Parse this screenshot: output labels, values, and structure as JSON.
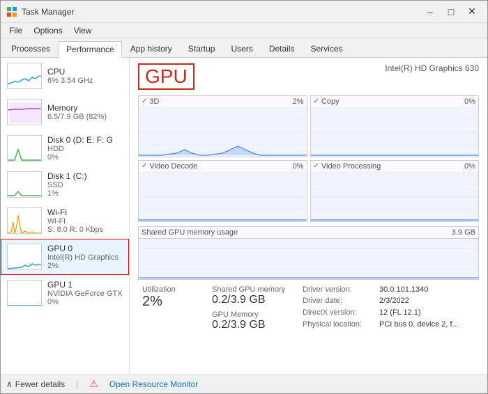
{
  "window": {
    "title": "Task Manager",
    "controls": {
      "minimize": "–",
      "maximize": "□",
      "close": "✕"
    }
  },
  "menu": {
    "items": [
      "File",
      "Options",
      "View"
    ]
  },
  "tabs": [
    {
      "label": "Processes",
      "active": false
    },
    {
      "label": "Performance",
      "active": true
    },
    {
      "label": "App history",
      "active": false
    },
    {
      "label": "Startup",
      "active": false
    },
    {
      "label": "Users",
      "active": false
    },
    {
      "label": "Details",
      "active": false
    },
    {
      "label": "Services",
      "active": false
    }
  ],
  "sidebar": {
    "items": [
      {
        "name": "CPU",
        "sub1": "6% 3.54 GHz",
        "sub2": "",
        "type": "cpu",
        "color": "#2ba0d4"
      },
      {
        "name": "Memory",
        "sub1": "6.5/7.9 GB (82%)",
        "sub2": "",
        "type": "memory",
        "color": "#9b59b6"
      },
      {
        "name": "Disk 0 (D: E: F: G",
        "sub1": "HDD",
        "sub2": "0%",
        "type": "disk0",
        "color": "#4caf50"
      },
      {
        "name": "Disk 1 (C:)",
        "sub1": "SSD",
        "sub2": "1%",
        "type": "disk1",
        "color": "#4caf50"
      },
      {
        "name": "Wi-Fi",
        "sub1": "Wi-Fi",
        "sub2": "S: 8.0  R: 0 Kbps",
        "type": "wifi",
        "color": "#ff9800"
      },
      {
        "name": "GPU 0",
        "sub1": "Intel(R) HD Graphics",
        "sub2": "2%",
        "type": "gpu0",
        "color": "#2ba0d4",
        "active": true
      },
      {
        "name": "GPU 1",
        "sub1": "NVIDIA GeForce GTX",
        "sub2": "0%",
        "type": "gpu1",
        "color": "#2ba0d4"
      }
    ]
  },
  "panel": {
    "title": "GPU",
    "subtitle": "Intel(R) HD Graphics 630",
    "charts": [
      {
        "label": "3D",
        "percent": "2%"
      },
      {
        "label": "Copy",
        "percent": "0%"
      },
      {
        "label": "Video Decode",
        "percent": "0%"
      },
      {
        "label": "Video Processing",
        "percent": "0%"
      }
    ],
    "shared_memory": {
      "label": "Shared GPU memory usage",
      "value": "3.9 GB"
    },
    "stats": {
      "utilization_label": "Utilization",
      "utilization_value": "2%",
      "shared_gpu_label": "Shared GPU memory",
      "shared_gpu_value": "0.2/3.9 GB",
      "gpu_memory_label": "GPU Memory",
      "gpu_memory_value": "0.2/3.9 GB"
    },
    "details": {
      "driver_version_label": "Driver version:",
      "driver_version_value": "30.0.101.1340",
      "driver_date_label": "Driver date:",
      "driver_date_value": "2/3/2022",
      "directx_label": "DirectX version:",
      "directx_value": "12 (FL 12.1)",
      "physical_label": "Physical location:",
      "physical_value": "PCI bus 0, device 2, f..."
    }
  },
  "bottom": {
    "fewer_details": "Fewer details",
    "open_monitor": "Open Resource Monitor"
  }
}
